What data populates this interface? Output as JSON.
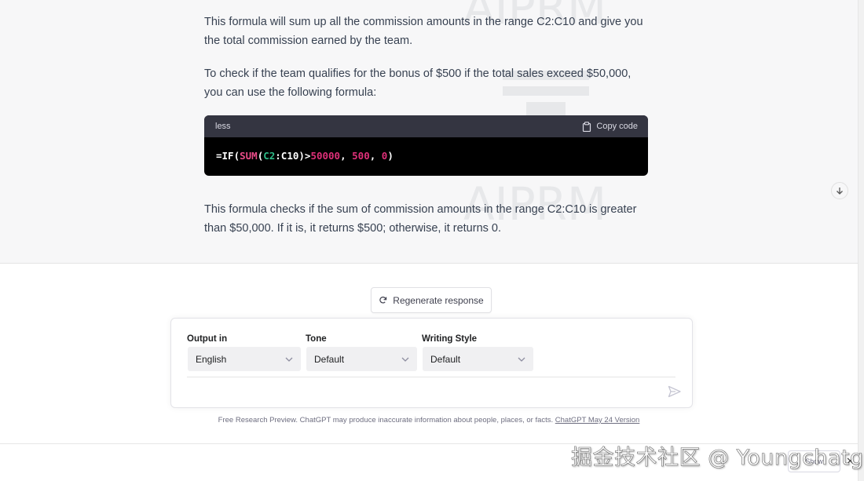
{
  "conversation": {
    "paragraphs": [
      "This formula will sum up all the commission amounts in the range C2:C10 and give you the total commission earned by the team.",
      "To check if the team qualifies for the bonus of $500 if the total sales exceed $50,000, you can use the following formula:",
      "This formula checks if the sum of commission amounts in the range C2:C10 is greater than $50,000. If it is, it returns $500; otherwise, it returns 0."
    ],
    "code": {
      "language": "less",
      "copy_label": "Copy code",
      "tokens": {
        "eq_if": "=IF(",
        "sum": "SUM",
        "open": "(",
        "ref": "C2",
        "range_rest": ":C10)>",
        "threshold": "50000",
        "sep1": ", ",
        "bonus": "500",
        "sep2": ", ",
        "zero": "0",
        "close": ")"
      }
    },
    "watermark_text": "AIPRM"
  },
  "actions": {
    "regenerate_label": "Regenerate response"
  },
  "composer": {
    "output_label": "Output in",
    "output_value": "English",
    "tone_label": "Tone",
    "tone_value": "Default",
    "style_label": "Writing Style",
    "style_value": "Default"
  },
  "footer": {
    "note": "Free Research Preview. ChatGPT may produce inaccurate information about people, places, or facts.",
    "version_link": "ChatGPT May 24 Version"
  },
  "overlay": {
    "cn_watermark": "掘金技术社区 @ Youngchatgpt",
    "show_label": "Show",
    "close_label": "✕"
  },
  "colors": {
    "chat_bg": "#f7f7f8",
    "code_bg": "#000000",
    "code_header_bg": "#343541",
    "sum_color": "#ea4c89",
    "ref_color": "#2ebc88",
    "num_color": "#df3079"
  }
}
